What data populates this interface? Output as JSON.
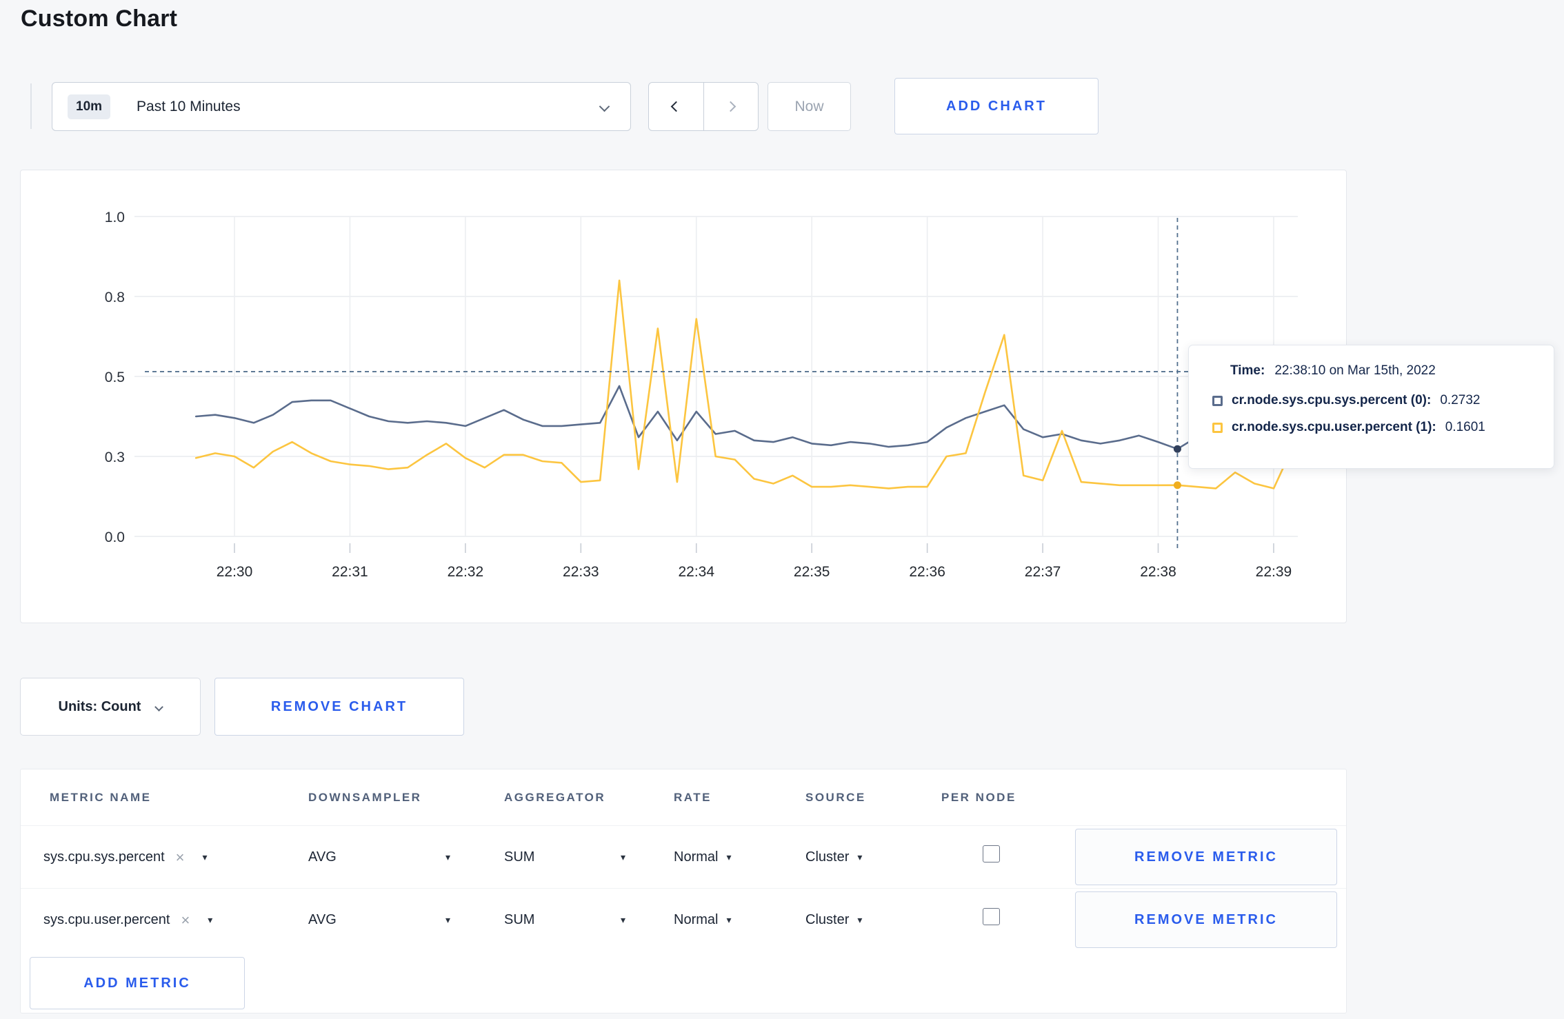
{
  "page": {
    "title": "Custom Chart",
    "background": "#f6f7f9",
    "accent_color": "#2a5cec"
  },
  "toolbar": {
    "time_badge": "10m",
    "time_label": "Past 10 Minutes",
    "now_label": "Now",
    "add_chart_label": "ADD CHART"
  },
  "chart": {
    "tooltip": {
      "time_label": "Time:",
      "time_value": "22:38:10 on Mar 15th, 2022",
      "rows": [
        {
          "label": "cr.node.sys.cpu.sys.percent (0):",
          "value": "0.2732"
        },
        {
          "label": "cr.node.sys.cpu.user.percent (1):",
          "value": "0.1601"
        }
      ]
    }
  },
  "chart_data": {
    "type": "line",
    "title": "",
    "xlabel": "",
    "ylabel": "",
    "ylim": [
      0,
      1
    ],
    "grid": true,
    "x_ticks": [
      "22:30",
      "22:31",
      "22:32",
      "22:33",
      "22:34",
      "22:35",
      "22:36",
      "22:37",
      "22:38",
      "22:39"
    ],
    "y_ticks": [
      {
        "label": "1.0",
        "value": 1.0
      },
      {
        "label": "0.8",
        "value": 0.75
      },
      {
        "label": "0.5",
        "value": 0.5
      },
      {
        "label": "0.3",
        "value": 0.25
      },
      {
        "label": "0.0",
        "value": 0.0
      }
    ],
    "time_axis": {
      "start_time": "22:29:40",
      "interval_seconds": 10,
      "start_offset_seconds_from_2230": -20
    },
    "series": [
      {
        "name": "cr.node.sys.cpu.sys.percent",
        "color": "#5a6c8c",
        "values": [
          0.375,
          0.38,
          0.37,
          0.355,
          0.38,
          0.42,
          0.425,
          0.425,
          0.4,
          0.375,
          0.36,
          0.355,
          0.36,
          0.355,
          0.345,
          0.37,
          0.395,
          0.365,
          0.345,
          0.345,
          0.35,
          0.355,
          0.47,
          0.31,
          0.39,
          0.3,
          0.39,
          0.32,
          0.33,
          0.3,
          0.295,
          0.31,
          0.29,
          0.285,
          0.295,
          0.29,
          0.28,
          0.285,
          0.295,
          0.34,
          0.37,
          0.39,
          0.41,
          0.335,
          0.31,
          0.32,
          0.3,
          0.29,
          0.3,
          0.315,
          0.295,
          0.2732,
          0.31,
          0.3,
          0.295,
          0.3,
          0.3,
          0.31
        ]
      },
      {
        "name": "cr.node.sys.cpu.user.percent",
        "color": "#fcc540",
        "values": [
          0.245,
          0.26,
          0.25,
          0.215,
          0.265,
          0.295,
          0.26,
          0.235,
          0.225,
          0.22,
          0.21,
          0.215,
          0.255,
          0.29,
          0.245,
          0.215,
          0.255,
          0.255,
          0.235,
          0.23,
          0.17,
          0.175,
          0.8,
          0.21,
          0.65,
          0.17,
          0.68,
          0.25,
          0.24,
          0.18,
          0.165,
          0.19,
          0.155,
          0.155,
          0.16,
          0.155,
          0.15,
          0.155,
          0.155,
          0.25,
          0.26,
          0.45,
          0.63,
          0.19,
          0.175,
          0.33,
          0.17,
          0.165,
          0.16,
          0.16,
          0.16,
          0.1601,
          0.155,
          0.15,
          0.2,
          0.165,
          0.15,
          0.28
        ]
      }
    ],
    "hover": {
      "time": "22:38:10",
      "t_seconds_from_2230": 490,
      "crosshair_value": 0.515,
      "values": [
        0.2732,
        0.1601
      ],
      "dot_colors": [
        "#31405c",
        "#f0ae1e"
      ]
    },
    "legend_position": "tooltip"
  },
  "units_row": {
    "units_label": "Units: Count",
    "remove_chart_label": "REMOVE CHART"
  },
  "metrics_table": {
    "headers": [
      "METRIC NAME",
      "DOWNSAMPLER",
      "AGGREGATOR",
      "RATE",
      "SOURCE",
      "PER NODE"
    ],
    "rows": [
      {
        "metric_name": "sys.cpu.sys.percent",
        "downsampler": "AVG",
        "aggregator": "SUM",
        "rate": "Normal",
        "source": "Cluster",
        "per_node_checked": false,
        "remove_label": "REMOVE METRIC"
      },
      {
        "metric_name": "sys.cpu.user.percent",
        "downsampler": "AVG",
        "aggregator": "SUM",
        "rate": "Normal",
        "source": "Cluster",
        "per_node_checked": false,
        "remove_label": "REMOVE METRIC"
      }
    ],
    "add_metric_label": "ADD METRIC"
  },
  "icons": {
    "close": "×",
    "caret_down": "▾"
  }
}
